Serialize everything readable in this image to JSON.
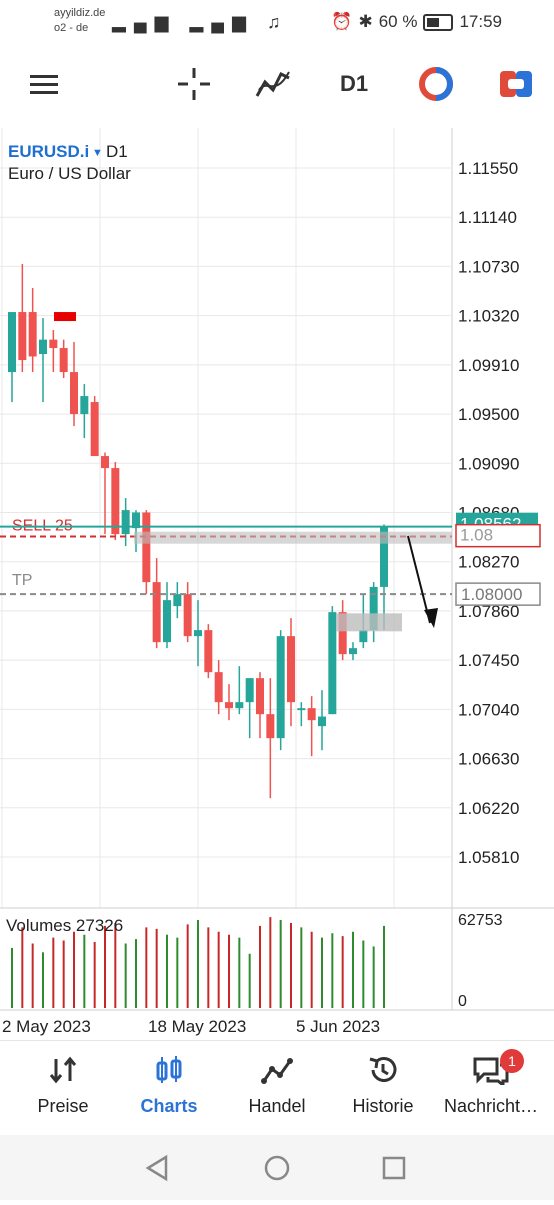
{
  "status": {
    "carrier_line1": "ayyildiz.de",
    "carrier_line2": "o2 - de",
    "battery": "60 %",
    "time": "17:59"
  },
  "toolbar": {
    "timeframe": "D1"
  },
  "chart": {
    "symbol": "EURUSD.i",
    "timeframe": "D1",
    "description": "Euro / US Dollar",
    "sell_label": "SELL 25",
    "tp_label": "TP",
    "current_price": "1.08562",
    "tp_price": "1.08000",
    "partial_price": "1.08",
    "volumes_label": "Volumes 27326",
    "volume_max": "62753",
    "volume_min": "0",
    "date_labels": [
      "2 May 2023",
      "18 May 2023",
      "5 Jun 2023"
    ],
    "price_labels": [
      "1.11550",
      "1.11140",
      "1.10730",
      "1.10320",
      "1.09910",
      "1.09500",
      "1.09090",
      "1.08680",
      "1.08270",
      "1.07860",
      "1.07450",
      "1.07040",
      "1.06630",
      "1.06220",
      "1.05810"
    ],
    "colors": {
      "bull": "#26a69a",
      "bear": "#ef5350",
      "sell": "#d32f2f",
      "tp": "#8a8a8a",
      "accent": "#2b73d6"
    }
  },
  "chart_data": {
    "type": "candlestick",
    "ylim": [
      1.055,
      1.118
    ],
    "candles": [
      {
        "o": 1.0985,
        "h": 1.1018,
        "l": 1.096,
        "c": 1.1035
      },
      {
        "o": 1.1035,
        "h": 1.1075,
        "l": 1.0985,
        "c": 1.0995
      },
      {
        "o": 1.1035,
        "h": 1.1055,
        "l": 1.0985,
        "c": 1.0998
      },
      {
        "o": 1.1,
        "h": 1.103,
        "l": 1.096,
        "c": 1.1012
      },
      {
        "o": 1.1012,
        "h": 1.102,
        "l": 1.0985,
        "c": 1.1005
      },
      {
        "o": 1.1005,
        "h": 1.1012,
        "l": 1.098,
        "c": 1.0985
      },
      {
        "o": 1.0985,
        "h": 1.101,
        "l": 1.094,
        "c": 1.095
      },
      {
        "o": 1.095,
        "h": 1.0975,
        "l": 1.093,
        "c": 1.0965
      },
      {
        "o": 1.096,
        "h": 1.0965,
        "l": 1.092,
        "c": 1.0915
      },
      {
        "o": 1.0915,
        "h": 1.0918,
        "l": 1.085,
        "c": 1.0905
      },
      {
        "o": 1.0905,
        "h": 1.091,
        "l": 1.0845,
        "c": 1.085
      },
      {
        "o": 1.085,
        "h": 1.088,
        "l": 1.084,
        "c": 1.087
      },
      {
        "o": 1.0855,
        "h": 1.087,
        "l": 1.0835,
        "c": 1.0868
      },
      {
        "o": 1.0868,
        "h": 1.087,
        "l": 1.08,
        "c": 1.081
      },
      {
        "o": 1.081,
        "h": 1.083,
        "l": 1.0755,
        "c": 1.076
      },
      {
        "o": 1.076,
        "h": 1.081,
        "l": 1.0755,
        "c": 1.0795
      },
      {
        "o": 1.079,
        "h": 1.081,
        "l": 1.078,
        "c": 1.08
      },
      {
        "o": 1.08,
        "h": 1.081,
        "l": 1.076,
        "c": 1.0765
      },
      {
        "o": 1.0765,
        "h": 1.0795,
        "l": 1.074,
        "c": 1.077
      },
      {
        "o": 1.077,
        "h": 1.0775,
        "l": 1.073,
        "c": 1.0735
      },
      {
        "o": 1.0735,
        "h": 1.0745,
        "l": 1.07,
        "c": 1.071
      },
      {
        "o": 1.071,
        "h": 1.0725,
        "l": 1.0695,
        "c": 1.0705
      },
      {
        "o": 1.0705,
        "h": 1.074,
        "l": 1.07,
        "c": 1.071
      },
      {
        "o": 1.071,
        "h": 1.073,
        "l": 1.068,
        "c": 1.073
      },
      {
        "o": 1.073,
        "h": 1.0735,
        "l": 1.068,
        "c": 1.07
      },
      {
        "o": 1.07,
        "h": 1.073,
        "l": 1.063,
        "c": 1.068
      },
      {
        "o": 1.068,
        "h": 1.077,
        "l": 1.067,
        "c": 1.0765
      },
      {
        "o": 1.0765,
        "h": 1.078,
        "l": 1.069,
        "c": 1.071
      },
      {
        "o": 1.0705,
        "h": 1.071,
        "l": 1.069,
        "c": 1.0705
      },
      {
        "o": 1.0705,
        "h": 1.0715,
        "l": 1.0665,
        "c": 1.0695
      },
      {
        "o": 1.069,
        "h": 1.072,
        "l": 1.067,
        "c": 1.0698
      },
      {
        "o": 1.07,
        "h": 1.079,
        "l": 1.07,
        "c": 1.0785
      },
      {
        "o": 1.0785,
        "h": 1.0795,
        "l": 1.0745,
        "c": 1.075
      },
      {
        "o": 1.075,
        "h": 1.076,
        "l": 1.0745,
        "c": 1.0755
      },
      {
        "o": 1.076,
        "h": 1.08,
        "l": 1.0755,
        "c": 1.077
      },
      {
        "o": 1.077,
        "h": 1.081,
        "l": 1.076,
        "c": 1.0806
      },
      {
        "o": 1.0806,
        "h": 1.0858,
        "l": 1.077,
        "c": 1.0856
      }
    ],
    "volumes": [
      41000,
      55000,
      44000,
      38000,
      48000,
      46000,
      52000,
      50000,
      45000,
      56000,
      58000,
      44000,
      47000,
      55000,
      54000,
      50000,
      48000,
      57000,
      60000,
      55000,
      52000,
      50000,
      48000,
      37000,
      56000,
      62000,
      60000,
      58000,
      55000,
      52000,
      48000,
      51000,
      49000,
      52000,
      46000,
      42000,
      56000
    ]
  }
}
